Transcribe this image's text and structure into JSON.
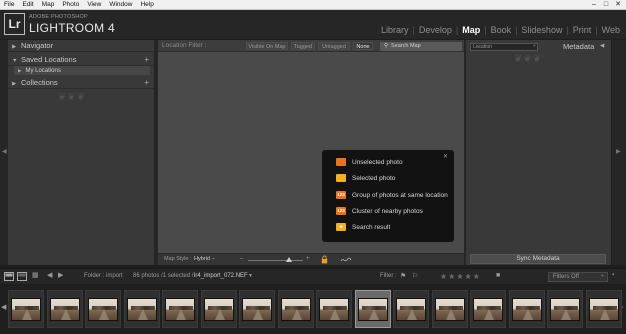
{
  "menu": [
    "File",
    "Edit",
    "Map",
    "Photo",
    "View",
    "Window",
    "Help"
  ],
  "window_controls": [
    "–",
    "□",
    "✕"
  ],
  "app": {
    "logo": "Lr",
    "vendor": "ADOBE PHOTOSHOP",
    "name": "LIGHTROOM 4"
  },
  "modules": [
    {
      "label": "Library",
      "active": false
    },
    {
      "label": "Develop",
      "active": false
    },
    {
      "label": "Map",
      "active": true
    },
    {
      "label": "Book",
      "active": false
    },
    {
      "label": "Slideshow",
      "active": false
    },
    {
      "label": "Print",
      "active": false
    },
    {
      "label": "Web",
      "active": false
    }
  ],
  "left_panel": {
    "navigator": "Navigator",
    "saved_locations": "Saved Locations",
    "my_locations": "My Locations",
    "collections": "Collections"
  },
  "location_filter": {
    "label": "Location Filter :",
    "buttons": [
      "Visible On Map",
      "Tagged",
      "Untagged",
      "None"
    ],
    "selected": "None",
    "search_placeholder": "Search Map"
  },
  "legend": {
    "items": [
      {
        "label": "Unselected photo",
        "color": "#e8741e",
        "badge": ""
      },
      {
        "label": "Selected photo",
        "color": "#f0b020",
        "badge": ""
      },
      {
        "label": "Group of photos at same location",
        "color": "#e8741e",
        "badge": "123"
      },
      {
        "label": "Cluster of nearby photos",
        "color": "#e8741e",
        "badge": "123"
      },
      {
        "label": "Search result",
        "color": "#f0b020",
        "badge": "★"
      }
    ]
  },
  "map_toolbar": {
    "style_label": "Map Style :",
    "style_value": "Hybrid"
  },
  "right_panel": {
    "location_field": "Location",
    "metadata": "Metadata",
    "sync_button": "Sync Metadata"
  },
  "filmstrip": {
    "folder": "Folder : import",
    "count": "86 photos /1 selected /",
    "filename": "lr4_import_072.NEF",
    "filter_label": "Filter :",
    "filters_off": "Filters Off",
    "page_numbers": [
      "1",
      "2"
    ],
    "thumb_count": 16,
    "selected_index": 9
  },
  "colors": {
    "accent_orange": "#e8741e",
    "accent_yellow": "#f0b020"
  }
}
